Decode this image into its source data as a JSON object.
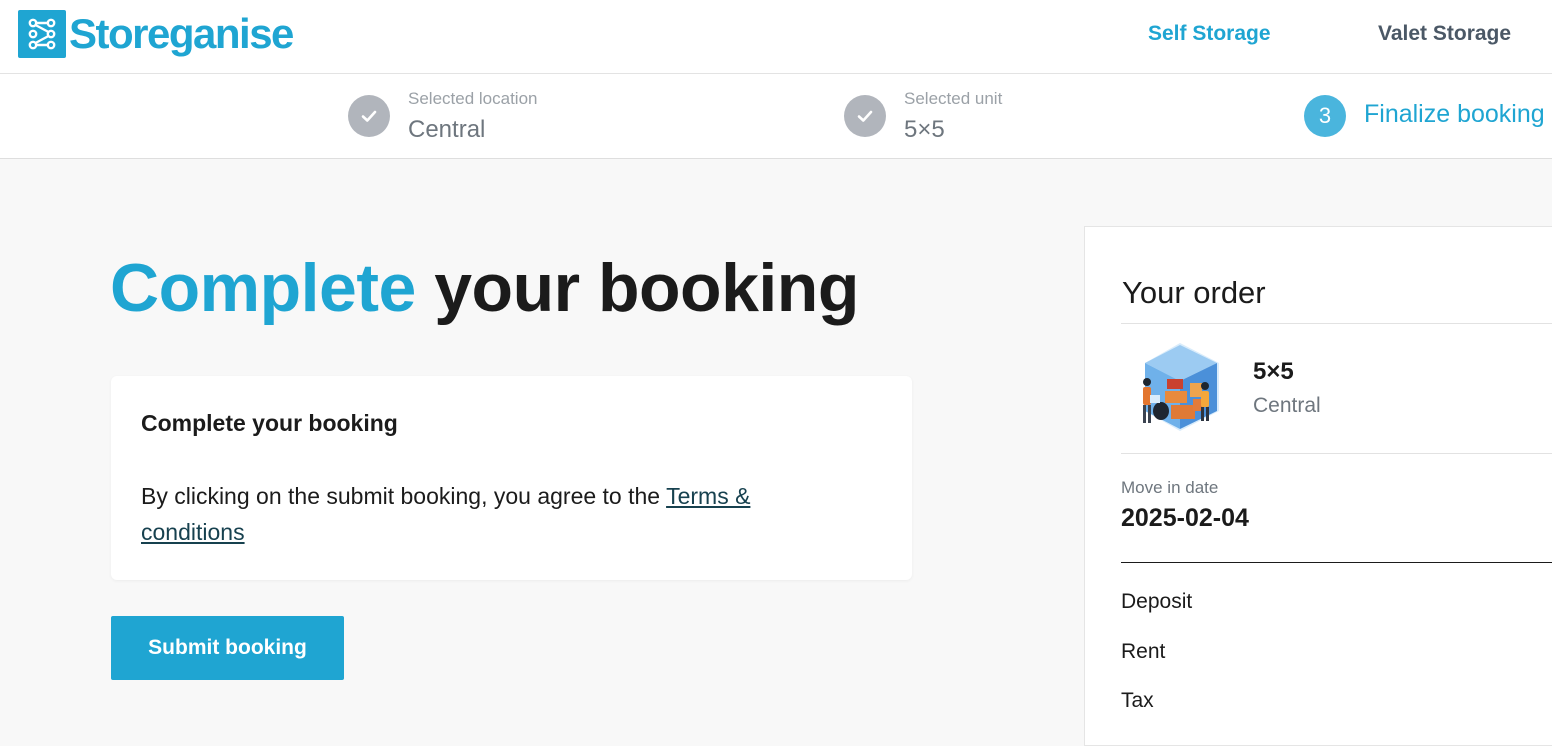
{
  "header": {
    "logo_text": "Storeganise",
    "nav": {
      "self_storage": "Self Storage",
      "valet_storage": "Valet Storage"
    }
  },
  "stepper": {
    "steps": [
      {
        "caption": "Selected location",
        "value": "Central",
        "status": "done",
        "icon": "check-icon"
      },
      {
        "caption": "Selected unit",
        "value": "5×5",
        "status": "done",
        "icon": "check-icon"
      },
      {
        "number": "3",
        "label": "Finalize booking",
        "status": "active"
      }
    ]
  },
  "main": {
    "title_accent": "Complete",
    "title_rest": "your booking",
    "card": {
      "title": "Complete your booking",
      "text": "By clicking on the submit booking, you agree to the",
      "link": "Terms & conditions"
    },
    "submit_label": "Submit booking"
  },
  "order": {
    "title": "Your order",
    "unit_name": "5×5",
    "unit_location": "Central",
    "move_in_label": "Move in date",
    "move_in_date": "2025-02-04",
    "rows": [
      "Deposit",
      "Rent",
      "Tax"
    ]
  },
  "colors": {
    "brand": "#1fa5d2",
    "step_done": "#b1b5bc",
    "step_active": "#4ab5dd"
  }
}
